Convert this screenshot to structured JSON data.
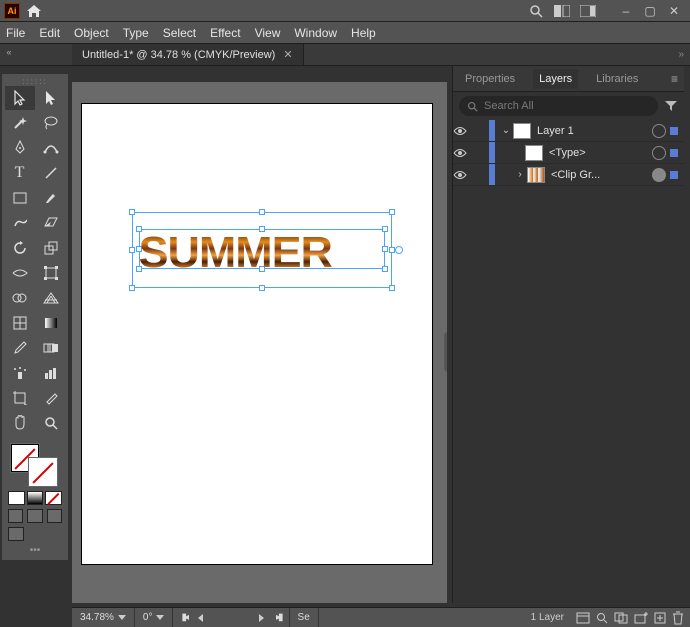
{
  "app": {
    "logo_text": "Ai"
  },
  "menubar": [
    "File",
    "Edit",
    "Object",
    "Type",
    "Select",
    "Effect",
    "View",
    "Window",
    "Help"
  ],
  "document": {
    "tab_title": "Untitled-1* @ 34.78 % (CMYK/Preview)",
    "zoom": "34.78%",
    "rotation": "0°",
    "canvas_text": "SUMMER"
  },
  "panels": {
    "tabs": [
      "Properties",
      "Layers",
      "Libraries"
    ],
    "active_tab": "Layers",
    "search_placeholder": "Search All",
    "layers": [
      {
        "name": "Layer 1",
        "expanded": true,
        "selected": true
      },
      {
        "name": "<Type>"
      },
      {
        "name": "<Clip Gr..."
      }
    ]
  },
  "status": {
    "layer_count": "1 Layer",
    "selection_info": "Se"
  }
}
